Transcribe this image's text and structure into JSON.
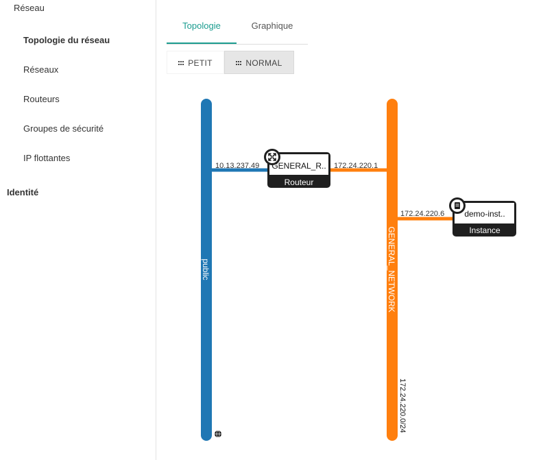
{
  "sidebar": {
    "section": "Réseau",
    "items": [
      {
        "label": "Topologie du réseau",
        "active": true
      },
      {
        "label": "Réseaux",
        "active": false
      },
      {
        "label": "Routeurs",
        "active": false
      },
      {
        "label": "Groupes de sécurité",
        "active": false
      },
      {
        "label": "IP flottantes",
        "active": false
      }
    ],
    "group": "Identité"
  },
  "tabs": [
    {
      "label": "Topologie",
      "active": true
    },
    {
      "label": "Graphique",
      "active": false
    }
  ],
  "size_buttons": [
    {
      "label": "PETIT",
      "icon": "grid-icon",
      "active": false
    },
    {
      "label": "NORMAL",
      "icon": "grid-icon",
      "active": true
    }
  ],
  "topology": {
    "networks": {
      "public": {
        "label": "public",
        "color": "#1f77b4",
        "icon": "globe-icon"
      },
      "general": {
        "label": "GENERAL_NETWORK",
        "color": "#ff7f0e",
        "cidr": "172.24.220.0/24"
      }
    },
    "router": {
      "name": "GENERAL_R..",
      "type": "Routeur",
      "icon": "router-icon",
      "ip_public": "10.13.237.49",
      "ip_general": "172.24.220.1"
    },
    "instance": {
      "name": "demo-inst..",
      "type": "Instance",
      "icon": "server-icon",
      "ip": "172.24.220.6"
    }
  },
  "colors": {
    "accent": "#1a9c8f",
    "node_dark": "#1f1f1f"
  }
}
